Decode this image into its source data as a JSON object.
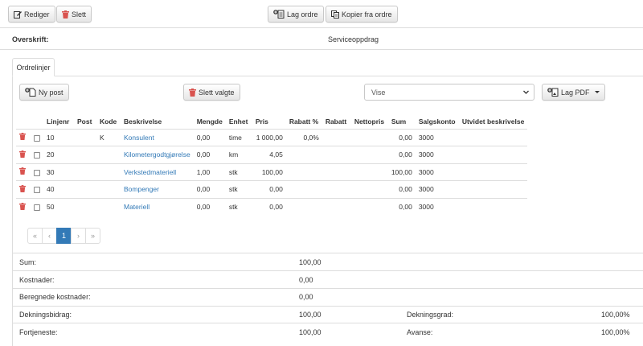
{
  "toolbar": {
    "edit_label": "Rediger",
    "delete_label": "Slett",
    "create_order_label": "Lag ordre",
    "copy_from_order_label": "Kopier fra ordre"
  },
  "header": {
    "overskrift_label": "Overskrift:",
    "overskrift_value": "Serviceoppdrag"
  },
  "tabs": [
    {
      "label": "Ordrelinjer"
    }
  ],
  "order_lines": {
    "new_post_label": "Ny post",
    "delete_selected_label": "Slett valgte",
    "view_select_value": "Vise",
    "create_pdf_label": "Lag PDF",
    "columns": [
      "Linjenr",
      "Post",
      "Kode",
      "Beskrivelse",
      "Mengde",
      "Enhet",
      "Pris",
      "Rabatt %",
      "Rabatt",
      "Nettopris",
      "Sum",
      "Salgskonto",
      "Utvidet beskrivelse"
    ],
    "rows": [
      {
        "linjenr": "10",
        "post": "",
        "kode": "K",
        "beskrivelse": "Konsulent",
        "mengde": "0,00",
        "enhet": "time",
        "pris": "1 000,00",
        "rabatt_pct": "0,0%",
        "rabatt": "",
        "nettopris": "",
        "sum": "0,00",
        "salgskonto": "3000",
        "utvidet": ""
      },
      {
        "linjenr": "20",
        "post": "",
        "kode": "",
        "beskrivelse": "Kilometergodtgjørelse",
        "mengde": "0,00",
        "enhet": "km",
        "pris": "4,05",
        "rabatt_pct": "",
        "rabatt": "",
        "nettopris": "",
        "sum": "0,00",
        "salgskonto": "3000",
        "utvidet": ""
      },
      {
        "linjenr": "30",
        "post": "",
        "kode": "",
        "beskrivelse": "Verkstedmateriell",
        "mengde": "1,00",
        "enhet": "stk",
        "pris": "100,00",
        "rabatt_pct": "",
        "rabatt": "",
        "nettopris": "",
        "sum": "100,00",
        "salgskonto": "3000",
        "utvidet": ""
      },
      {
        "linjenr": "40",
        "post": "",
        "kode": "",
        "beskrivelse": "Bompenger",
        "mengde": "0,00",
        "enhet": "stk",
        "pris": "0,00",
        "rabatt_pct": "",
        "rabatt": "",
        "nettopris": "",
        "sum": "0,00",
        "salgskonto": "3000",
        "utvidet": ""
      },
      {
        "linjenr": "50",
        "post": "",
        "kode": "",
        "beskrivelse": "Materiell",
        "mengde": "0,00",
        "enhet": "stk",
        "pris": "0,00",
        "rabatt_pct": "",
        "rabatt": "",
        "nettopris": "",
        "sum": "0,00",
        "salgskonto": "3000",
        "utvidet": ""
      }
    ]
  },
  "pagination": {
    "first": "«",
    "prev": "‹",
    "current": "1",
    "next": "›",
    "last": "»"
  },
  "summary": {
    "sum_label": "Sum:",
    "sum_value": "100,00",
    "kostnader_label": "Kostnader:",
    "kostnader_value": "0,00",
    "beregnede_label": "Beregnede kostnader:",
    "beregnede_value": "0,00",
    "dekningsbidrag_label": "Dekningsbidrag:",
    "dekningsbidrag_value": "100,00",
    "dekningsgrad_label": "Dekningsgrad:",
    "dekningsgrad_value": "100,00%",
    "fortjeneste_label": "Fortjeneste:",
    "fortjeneste_value": "100,00",
    "avanse_label": "Avanse:",
    "avanse_value": "100,00%"
  },
  "colors": {
    "link": "#337ab7",
    "trash": "#d9534f",
    "border": "#dddddd"
  }
}
